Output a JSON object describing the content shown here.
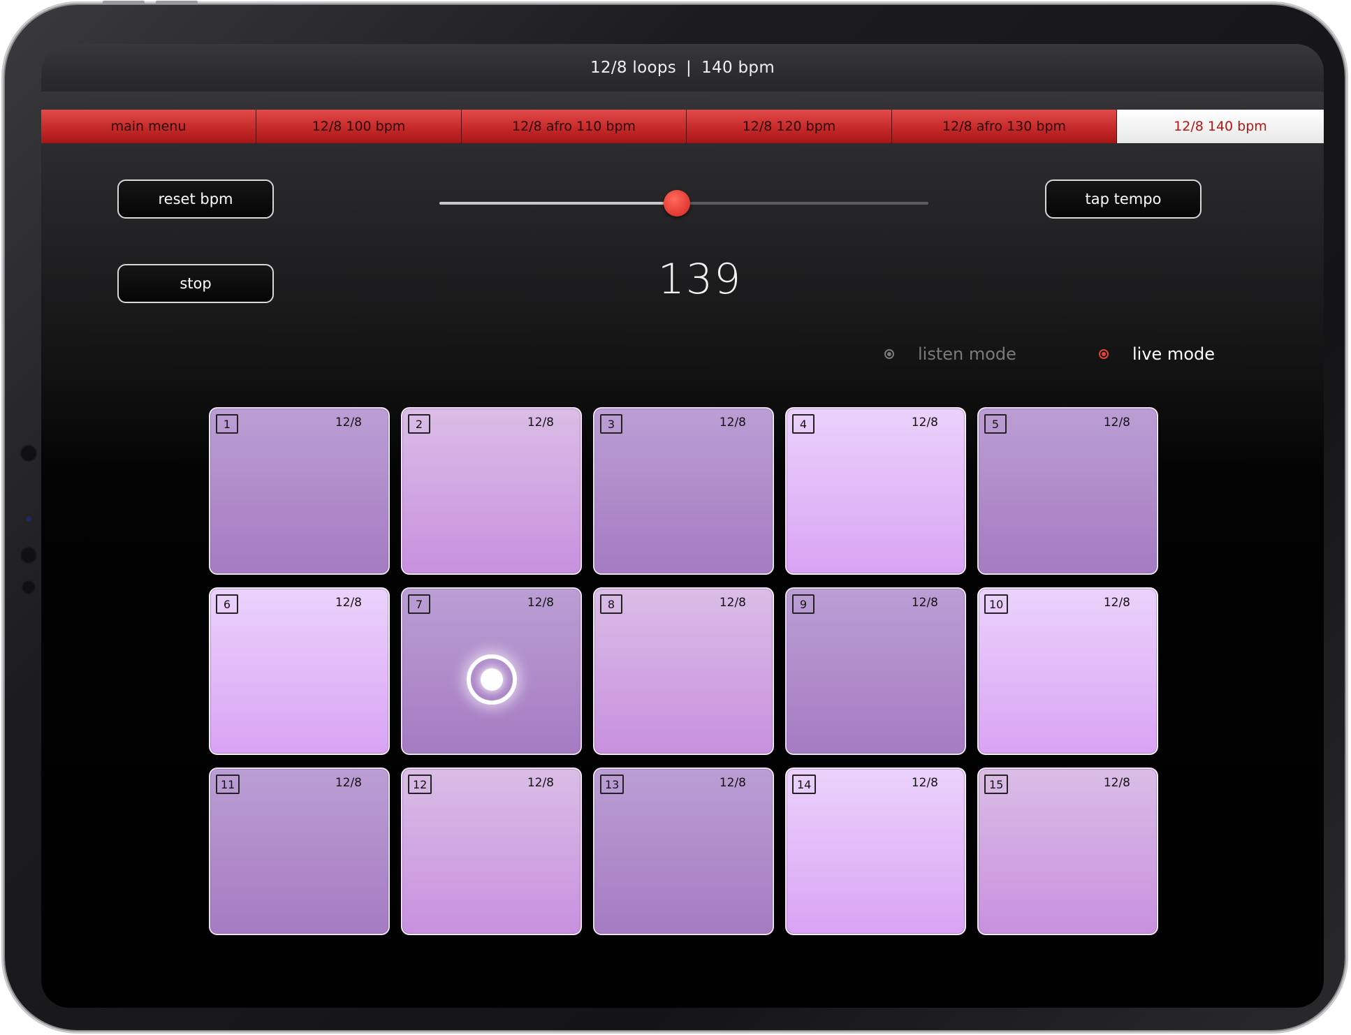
{
  "header": {
    "title_left": "12/8 loops",
    "separator": "|",
    "title_right": "140 bpm"
  },
  "tabs": [
    {
      "label": "main menu",
      "active": false
    },
    {
      "label": "12/8 100 bpm",
      "active": false
    },
    {
      "label": "12/8 afro 110 bpm",
      "active": false
    },
    {
      "label": "12/8 120 bpm",
      "active": false
    },
    {
      "label": "12/8 afro 130 bpm",
      "active": false
    },
    {
      "label": "12/8 140 bpm",
      "active": true
    }
  ],
  "controls": {
    "reset_label": "reset bpm",
    "stop_label": "stop",
    "tap_label": "tap tempo",
    "bpm_value": "139",
    "slider_fraction": 0.485,
    "accent_color": "#e8423a"
  },
  "modes": {
    "listen_label": "listen mode",
    "live_label": "live mode",
    "selected": "live"
  },
  "pads": [
    {
      "number": "1",
      "meter": "12/8",
      "shade": "s1"
    },
    {
      "number": "2",
      "meter": "12/8",
      "shade": "s2"
    },
    {
      "number": "3",
      "meter": "12/8",
      "shade": "s1"
    },
    {
      "number": "4",
      "meter": "12/8",
      "shade": "s3"
    },
    {
      "number": "5",
      "meter": "12/8",
      "shade": "s1"
    },
    {
      "number": "6",
      "meter": "12/8",
      "shade": "s3"
    },
    {
      "number": "7",
      "meter": "12/8",
      "shade": "s1",
      "playing": true
    },
    {
      "number": "8",
      "meter": "12/8",
      "shade": "s2"
    },
    {
      "number": "9",
      "meter": "12/8",
      "shade": "s1"
    },
    {
      "number": "10",
      "meter": "12/8",
      "shade": "s3"
    },
    {
      "number": "11",
      "meter": "12/8",
      "shade": "s1"
    },
    {
      "number": "12",
      "meter": "12/8",
      "shade": "s2"
    },
    {
      "number": "13",
      "meter": "12/8",
      "shade": "s1"
    },
    {
      "number": "14",
      "meter": "12/8",
      "shade": "s3"
    },
    {
      "number": "15",
      "meter": "12/8",
      "shade": "s2"
    }
  ]
}
